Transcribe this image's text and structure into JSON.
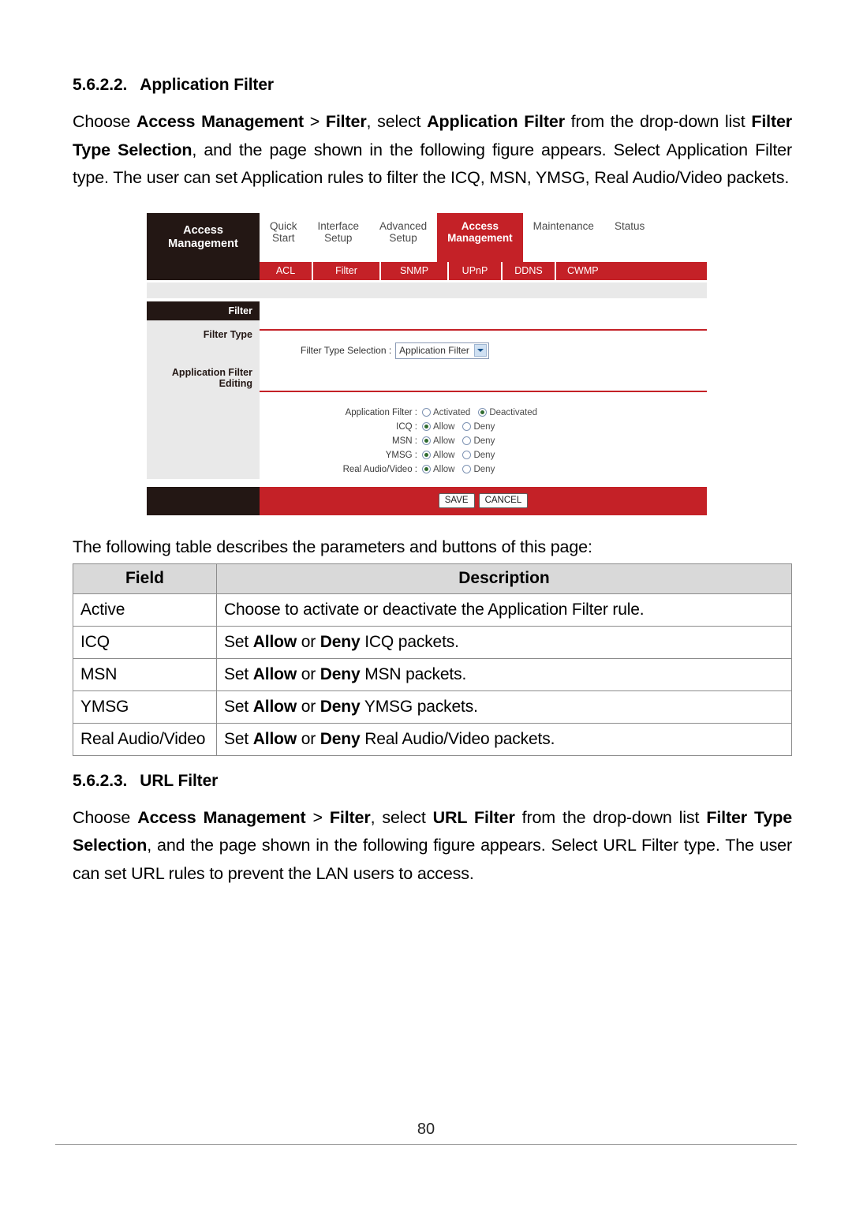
{
  "document": {
    "page_number": "80"
  },
  "sections": [
    {
      "number": "5.6.2.2.",
      "title": "Application Filter",
      "paragraph_parts": [
        {
          "t": "Choose ",
          "b": false
        },
        {
          "t": "Access Management",
          "b": true
        },
        {
          "t": " > ",
          "b": false
        },
        {
          "t": "Filter",
          "b": true
        },
        {
          "t": ", select ",
          "b": false
        },
        {
          "t": "Application Filter",
          "b": true
        },
        {
          "t": " from the drop-down list ",
          "b": false
        },
        {
          "t": "Filter Type Selection",
          "b": true
        },
        {
          "t": ", and the page shown in the following figure appears. Select Application Filter type. The user can set Application rules to filter the ICQ, MSN, YMSG, Real Audio/Video packets.",
          "b": false
        }
      ]
    },
    {
      "number": "5.6.2.3.",
      "title": "URL Filter",
      "paragraph_parts": [
        {
          "t": "Choose ",
          "b": false
        },
        {
          "t": "Access Management",
          "b": true
        },
        {
          "t": " > ",
          "b": false
        },
        {
          "t": "Filter",
          "b": true
        },
        {
          "t": ", select ",
          "b": false
        },
        {
          "t": "URL Filter",
          "b": true
        },
        {
          "t": " from the drop-down list ",
          "b": false
        },
        {
          "t": "Filter Type Selection",
          "b": true
        },
        {
          "t": ", and the page shown in the following figure appears. Select URL Filter type. The user can set URL rules to prevent the LAN users to access.",
          "b": false
        }
      ]
    }
  ],
  "table_intro": "The following table describes the parameters and buttons of this page:",
  "params_table": {
    "headers": [
      "Field",
      "Description"
    ],
    "rows": [
      {
        "field": "Active",
        "desc_parts": [
          {
            "t": "Choose to activate or deactivate the Application Filter rule.",
            "b": false
          }
        ]
      },
      {
        "field": "ICQ",
        "desc_parts": [
          {
            "t": "Set ",
            "b": false
          },
          {
            "t": "Allow",
            "b": true
          },
          {
            "t": " or ",
            "b": false
          },
          {
            "t": "Deny",
            "b": true
          },
          {
            "t": " ICQ packets.",
            "b": false
          }
        ]
      },
      {
        "field": "MSN",
        "desc_parts": [
          {
            "t": "Set ",
            "b": false
          },
          {
            "t": "Allow",
            "b": true
          },
          {
            "t": " or ",
            "b": false
          },
          {
            "t": "Deny",
            "b": true
          },
          {
            "t": " MSN packets.",
            "b": false
          }
        ]
      },
      {
        "field": "YMSG",
        "desc_parts": [
          {
            "t": "Set ",
            "b": false
          },
          {
            "t": "Allow",
            "b": true
          },
          {
            "t": " or ",
            "b": false
          },
          {
            "t": "Deny",
            "b": true
          },
          {
            "t": " YMSG packets.",
            "b": false
          }
        ]
      },
      {
        "field": "Real Audio/Video",
        "desc_parts": [
          {
            "t": "Set ",
            "b": false
          },
          {
            "t": "Allow",
            "b": true
          },
          {
            "t": " or ",
            "b": false
          },
          {
            "t": "Deny",
            "b": true
          },
          {
            "t": " Real Audio/Video packets.",
            "b": false
          }
        ]
      }
    ]
  },
  "figure": {
    "brand": "Access\nManagement",
    "main_tabs": [
      {
        "label": "Quick\nStart",
        "active": false
      },
      {
        "label": "Interface\nSetup",
        "active": false
      },
      {
        "label": "Advanced\nSetup",
        "active": false
      },
      {
        "label": "Access\nManagement",
        "active": true
      },
      {
        "label": "Maintenance",
        "active": false
      },
      {
        "label": "Status",
        "active": false
      }
    ],
    "sub_tabs": [
      "ACL",
      "Filter",
      "SNMP",
      "UPnP",
      "DDNS",
      "CWMP"
    ],
    "side": {
      "title": "Filter",
      "label_filter_type": "Filter Type",
      "label_editing": "Application Filter Editing"
    },
    "filter_type": {
      "label": "Filter Type Selection :",
      "value": "Application Filter"
    },
    "radios": [
      {
        "label": "Application Filter :",
        "options": [
          {
            "text": "Activated",
            "selected": false
          },
          {
            "text": "Deactivated",
            "selected": true
          }
        ]
      },
      {
        "label": "ICQ :",
        "options": [
          {
            "text": "Allow",
            "selected": true
          },
          {
            "text": "Deny",
            "selected": false
          }
        ]
      },
      {
        "label": "MSN :",
        "options": [
          {
            "text": "Allow",
            "selected": true
          },
          {
            "text": "Deny",
            "selected": false
          }
        ]
      },
      {
        "label": "YMSG :",
        "options": [
          {
            "text": "Allow",
            "selected": true
          },
          {
            "text": "Deny",
            "selected": false
          }
        ]
      },
      {
        "label": "Real Audio/Video :",
        "options": [
          {
            "text": "Allow",
            "selected": true
          },
          {
            "text": "Deny",
            "selected": false
          }
        ]
      }
    ],
    "buttons": {
      "save": "SAVE",
      "cancel": "CANCEL"
    }
  },
  "colors": {
    "accent_red": "#c42127",
    "dark_brown": "#231714",
    "panel_gray": "#e9e9e9",
    "header_gray": "#d9d9d9"
  }
}
